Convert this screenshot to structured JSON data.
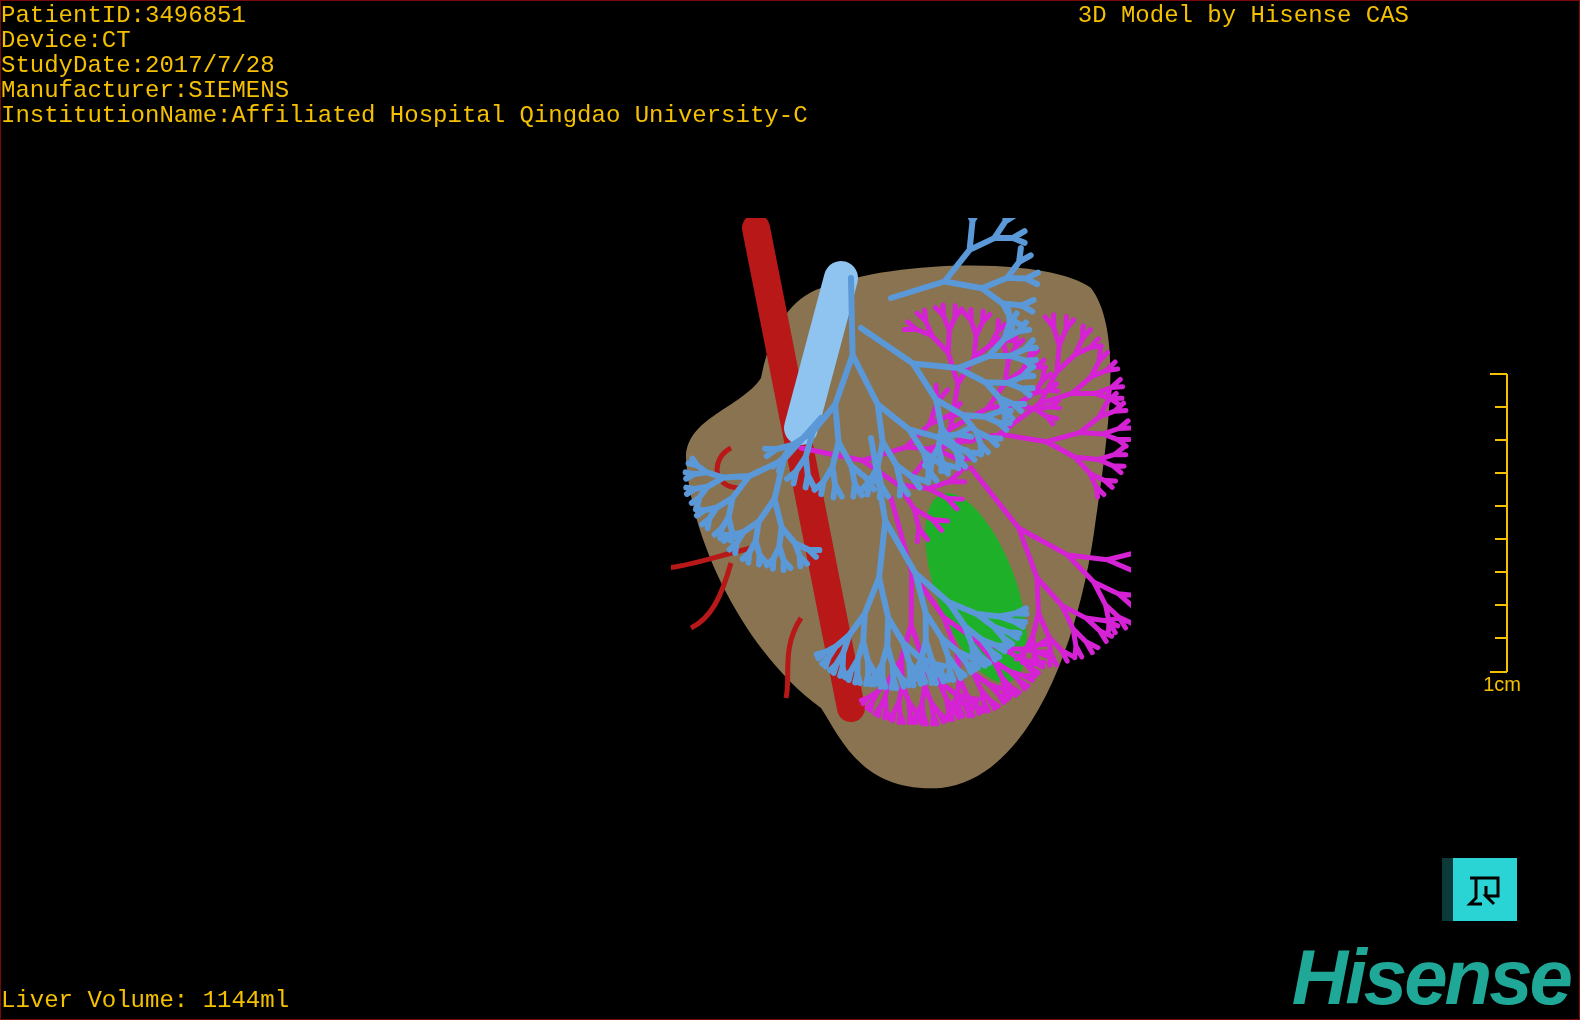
{
  "patient_info": [
    "PatientID:3496851",
    "Device:CT",
    "StudyDate:2017/7/28",
    "Manufacturer:SIEMENS",
    "InstitutionName:Affiliated Hospital Qingdao University-C"
  ],
  "title": "3D Model by Hisense CAS",
  "scale_bar": {
    "label": "1cm"
  },
  "liver_volume": "Liver Volume: 1144ml",
  "logo": {
    "text": "Hisense"
  }
}
